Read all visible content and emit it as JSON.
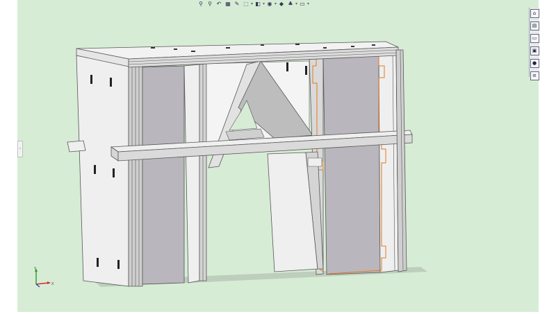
{
  "toolbar": {
    "icons": [
      "zoom-to-fit-icon",
      "zoom-to-area-icon",
      "previous-view-icon",
      "section-view-icon",
      "dynamic-annotation-icon",
      "view-orientation-icon",
      "display-style-icon",
      "hide-show-items-icon",
      "edit-appearance-icon",
      "apply-scene-icon",
      "view-settings-icon"
    ],
    "glyphs": [
      "⚲",
      "⚲",
      "↶",
      "▦",
      "✎",
      "⬚",
      "◧",
      "◉",
      "◆",
      "♣",
      "▭"
    ]
  },
  "task_pane": {
    "items": [
      {
        "name": "home-icon",
        "glyph": "⌂"
      },
      {
        "name": "design-library-icon",
        "glyph": "▤"
      },
      {
        "name": "file-explorer-icon",
        "glyph": "▭"
      },
      {
        "name": "view-palette-icon",
        "glyph": "▣"
      },
      {
        "name": "appearances-icon",
        "glyph": "●"
      },
      {
        "name": "custom-properties-icon",
        "glyph": "≡"
      }
    ]
  },
  "triad": {
    "x_label": "X",
    "y_label": "Y"
  },
  "status_bar": {
    "text": ""
  },
  "colors": {
    "background": "#d7ecd5",
    "part_light": "#efefef",
    "part_mid": "#d4d4d4",
    "part_dark": "#b9b6bd",
    "selection": "#e07a20"
  }
}
